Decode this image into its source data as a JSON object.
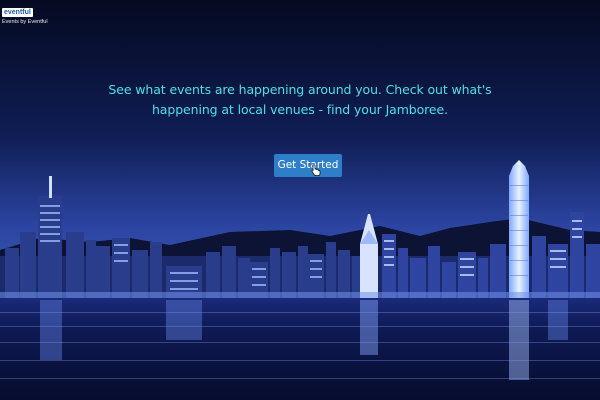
{
  "brand": {
    "logo_text": "eventful",
    "subtitle": "Events by Eventful"
  },
  "hero": {
    "headline_line1": "See what events are happening around you. Check out what's",
    "headline_line2": "happening at local venues - find your Jamboree.",
    "cta_label": "Get Started"
  },
  "colors": {
    "headline": "#4fe0e6",
    "button": "#2e7fc7",
    "sky_top": "#070d26",
    "sky_bottom": "#2a3f8f",
    "water": "#0a1540"
  },
  "icons": {
    "cursor": "hand-pointer-cursor"
  }
}
